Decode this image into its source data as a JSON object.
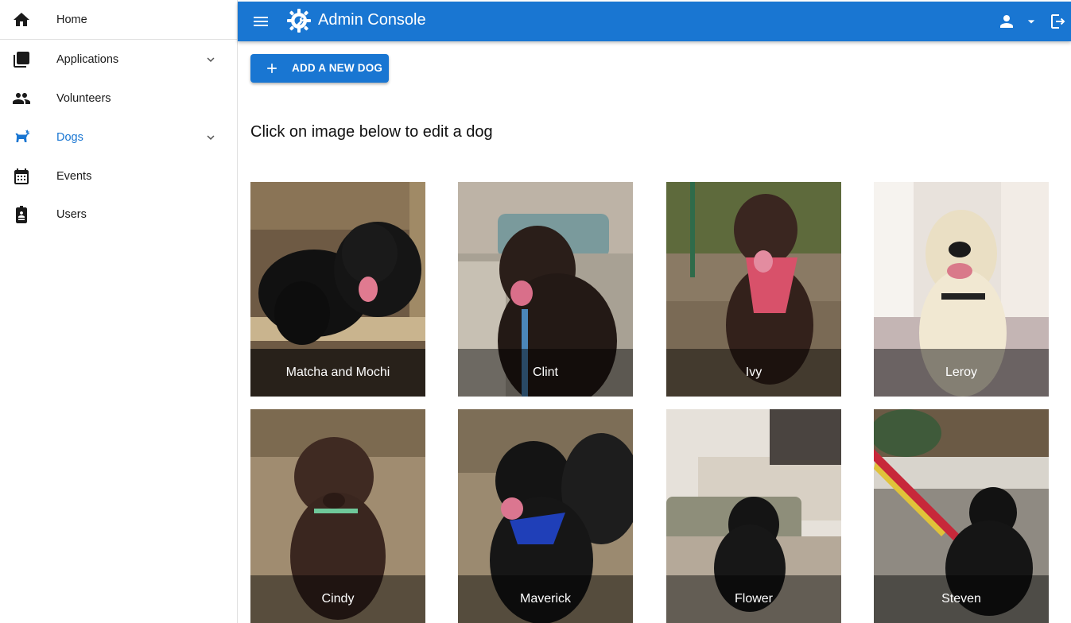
{
  "sidebar": {
    "items": [
      {
        "label": "Home",
        "icon": "home-icon"
      },
      {
        "label": "Applications",
        "icon": "library-books-icon",
        "expandable": true
      },
      {
        "label": "Volunteers",
        "icon": "people-icon"
      },
      {
        "label": "Dogs",
        "icon": "dog-icon",
        "expandable": true,
        "active": true
      },
      {
        "label": "Events",
        "icon": "calendar-icon"
      },
      {
        "label": "Users",
        "icon": "badge-icon"
      }
    ]
  },
  "appbar": {
    "title": "Admin Console",
    "color": "#1976d2"
  },
  "main": {
    "add_button_label": "ADD A NEW DOG",
    "instruction": "Click on image below to edit a dog",
    "dogs": [
      {
        "name": "Matcha and Mochi"
      },
      {
        "name": "Clint"
      },
      {
        "name": "Ivy"
      },
      {
        "name": "Leroy"
      },
      {
        "name": "Cindy"
      },
      {
        "name": "Maverick"
      },
      {
        "name": "Flower"
      },
      {
        "name": "Steven"
      }
    ]
  },
  "colors": {
    "accent": "#1976d2",
    "caption_overlay": "rgba(0,0,0,0.45)"
  }
}
